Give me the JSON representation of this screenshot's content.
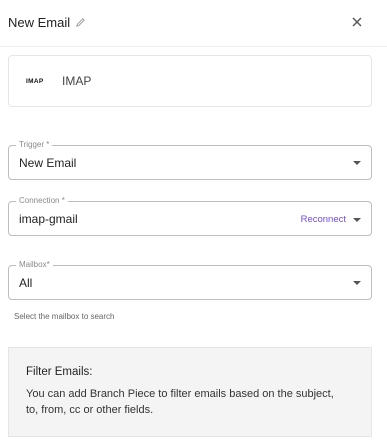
{
  "header": {
    "title": "New Email",
    "edit_icon": "pencil-icon",
    "close_icon": "close-icon"
  },
  "piece": {
    "logo_text": "IMAP",
    "name": "IMAP"
  },
  "fields": {
    "trigger": {
      "label": "Trigger *",
      "value": "New Email"
    },
    "connection": {
      "label": "Connection *",
      "value": "imap-gmail",
      "action": "Reconnect"
    },
    "mailbox": {
      "label": "Mailbox*",
      "value": "All",
      "helper": "Select the mailbox to search"
    }
  },
  "filter": {
    "title": "Filter Emails:",
    "text": "You can add Branch Piece to filter emails based on the subject, to, from, cc or other fields."
  },
  "colors": {
    "accent": "#6f4ee0",
    "border": "#bdbdbd",
    "filter_bg": "#f4f4f5"
  }
}
